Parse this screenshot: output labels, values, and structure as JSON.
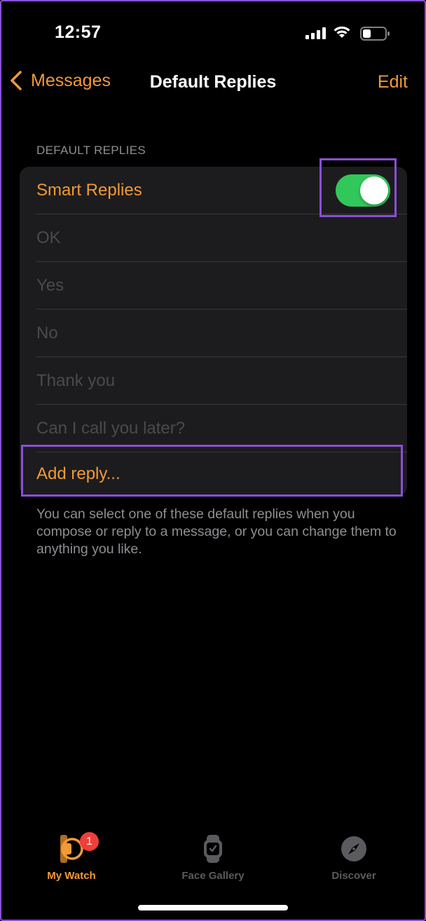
{
  "status_bar": {
    "time": "12:57"
  },
  "nav": {
    "back_label": "Messages",
    "title": "Default Replies",
    "edit_label": "Edit"
  },
  "section": {
    "header": "DEFAULT REPLIES"
  },
  "smart_replies": {
    "label": "Smart Replies",
    "enabled": true
  },
  "replies": [
    "OK",
    "Yes",
    "No",
    "Thank you",
    "Can I call you later?"
  ],
  "add_reply_label": "Add reply...",
  "footer_text": "You can select one of these default replies when you compose or reply to a message, or you can change them to anything you like.",
  "tabs": [
    {
      "label": "My Watch",
      "icon": "watch-icon",
      "active": true,
      "badge": "1"
    },
    {
      "label": "Face Gallery",
      "icon": "face-gallery-icon",
      "active": false
    },
    {
      "label": "Discover",
      "icon": "compass-icon",
      "active": false
    }
  ],
  "colors": {
    "accent": "#f19a37",
    "toggle_on": "#32c75a",
    "highlight": "#8b4ed8",
    "badge": "#ef3f3a"
  }
}
